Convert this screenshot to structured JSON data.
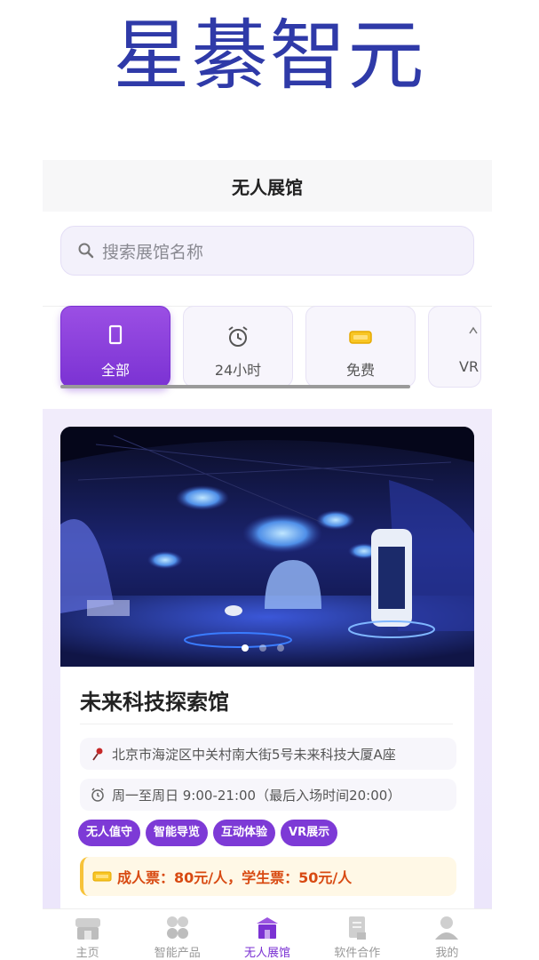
{
  "brand": {
    "title": "星綦智元"
  },
  "header": {
    "title": "无人展馆"
  },
  "search": {
    "placeholder": "搜索展馆名称"
  },
  "categories": [
    {
      "label": "全部",
      "icon": "phone-icon",
      "active": true
    },
    {
      "label": "24小时",
      "icon": "alarm-clock-icon",
      "active": false
    },
    {
      "label": "免费",
      "icon": "ticket-icon",
      "active": false
    },
    {
      "label": "VR",
      "icon": "vr-icon",
      "active": false
    }
  ],
  "venue": {
    "name": "未来科技探索馆",
    "address": "北京市海淀区中关村南大街5号未来科技大厦A座",
    "hours": "周一至周日 9:00-21:00（最后入场时间20:00）",
    "tags": [
      "无人值守",
      "智能导览",
      "互动体验",
      "VR展示"
    ],
    "price": "成人票：80元/人，学生票：50元/人"
  },
  "tabbar": {
    "items": [
      {
        "label": "主页",
        "icon": "home-icon",
        "active": false
      },
      {
        "label": "智能产品",
        "icon": "grid-icon",
        "active": false
      },
      {
        "label": "无人展馆",
        "icon": "building-icon",
        "active": true
      },
      {
        "label": "软件合作",
        "icon": "document-icon",
        "active": false
      },
      {
        "label": "我的",
        "icon": "user-icon",
        "active": false
      }
    ]
  },
  "colors": {
    "brand": "#2f3aa8",
    "accent": "#7b32d3",
    "price": "#d84a12"
  }
}
